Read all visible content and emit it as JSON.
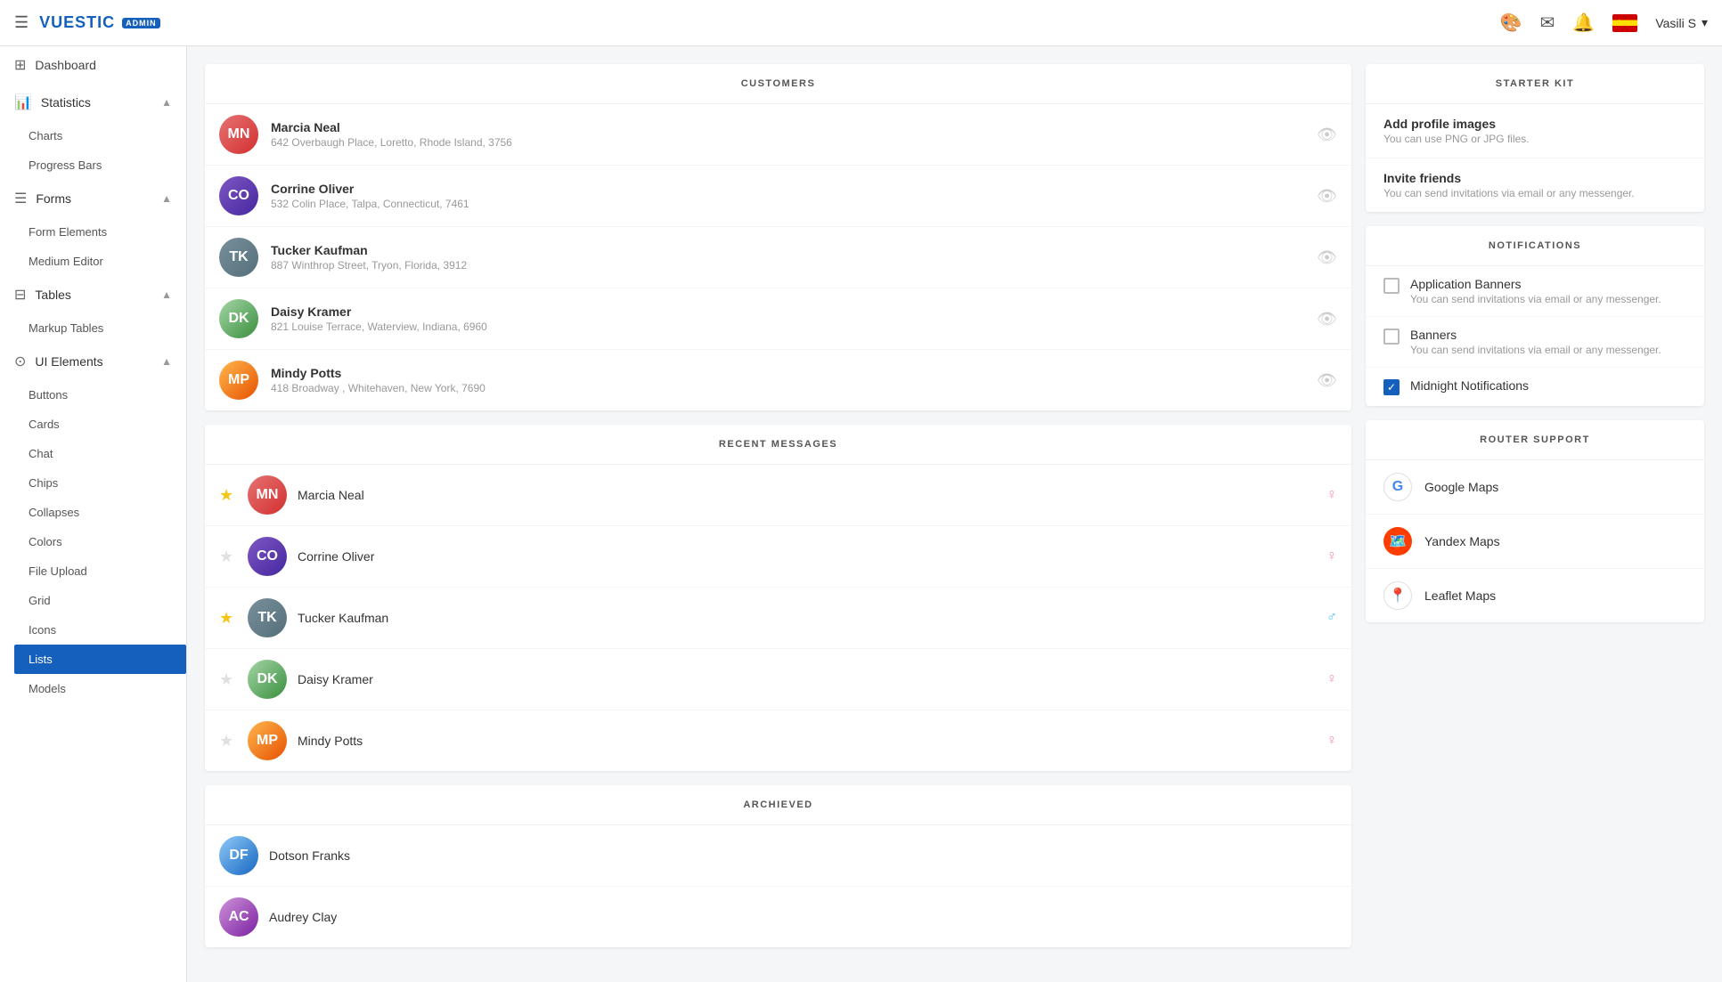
{
  "topnav": {
    "hamburger": "☰",
    "logo_text": "VUESTIC",
    "logo_badge": "ADMIN",
    "icons": {
      "color_wheel": "🎨",
      "mail": "✉",
      "bell": "🔔"
    },
    "user": "Vasili S",
    "user_chevron": "▾"
  },
  "sidebar": {
    "items": [
      {
        "id": "dashboard",
        "icon": "⊞",
        "label": "Dashboard"
      },
      {
        "id": "statistics",
        "icon": "📊",
        "label": "Statistics",
        "expanded": true,
        "children": [
          "Charts",
          "Progress Bars"
        ]
      },
      {
        "id": "forms",
        "icon": "☰",
        "label": "Forms",
        "expanded": true,
        "children": [
          "Form Elements",
          "Medium Editor"
        ]
      },
      {
        "id": "tables",
        "icon": "⊟",
        "label": "Tables",
        "expanded": true,
        "children": [
          "Markup Tables"
        ]
      },
      {
        "id": "ui-elements",
        "icon": "⊙",
        "label": "UI Elements",
        "expanded": true,
        "children": [
          "Buttons",
          "Cards",
          "Chat",
          "Chips",
          "Collapses",
          "Colors",
          "File Upload",
          "Grid",
          "Icons",
          "Lists",
          "Models"
        ]
      }
    ],
    "active": "Lists"
  },
  "customers": {
    "title": "CUSTOMERS",
    "items": [
      {
        "name": "Marcia Neal",
        "address": "642 Overbaugh Place, Loretto, Rhode Island, 3756",
        "av": "av1"
      },
      {
        "name": "Corrine Oliver",
        "address": "532 Colin Place, Talpa, Connecticut, 7461",
        "av": "av2"
      },
      {
        "name": "Tucker Kaufman",
        "address": "887 Winthrop Street, Tryon, Florida, 3912",
        "av": "av3"
      },
      {
        "name": "Daisy Kramer",
        "address": "821 Louise Terrace, Waterview, Indiana, 6960",
        "av": "av4"
      },
      {
        "name": "Mindy Potts",
        "address": "418 Broadway , Whitehaven, New York, 7690",
        "av": "av5"
      }
    ]
  },
  "recent_messages": {
    "title": "RECENT MESSAGES",
    "items": [
      {
        "name": "Marcia Neal",
        "starred": true,
        "gender": "female",
        "av": "av1"
      },
      {
        "name": "Corrine Oliver",
        "starred": false,
        "gender": "female",
        "av": "av2"
      },
      {
        "name": "Tucker Kaufman",
        "starred": true,
        "gender": "male",
        "av": "av3"
      },
      {
        "name": "Daisy Kramer",
        "starred": false,
        "gender": "female",
        "av": "av4"
      },
      {
        "name": "Mindy Potts",
        "starred": false,
        "gender": "female",
        "av": "av5"
      }
    ]
  },
  "archived": {
    "title": "ARCHIEVED",
    "items": [
      {
        "name": "Dotson Franks",
        "av": "av6"
      },
      {
        "name": "Audrey Clay",
        "av": "av7"
      }
    ]
  },
  "starter_kit": {
    "title": "STARTER KIT",
    "items": [
      {
        "title": "Add profile images",
        "sub": "You can use PNG or JPG files."
      },
      {
        "title": "Invite friends",
        "sub": "You can send invitations via email or any messenger."
      }
    ]
  },
  "notifications": {
    "title": "NOTIFICATIONS",
    "items": [
      {
        "title": "Application Banners",
        "sub": "You can send invitations via email or any messenger.",
        "checked": false
      },
      {
        "title": "Banners",
        "sub": "You can send invitations via email or any messenger.",
        "checked": false
      },
      {
        "title": "Midnight Notifications",
        "sub": "",
        "checked": true
      }
    ]
  },
  "router_support": {
    "title": "ROUTER SUPPORT",
    "items": [
      {
        "label": "Google Maps",
        "icon": "G",
        "style": "router-g"
      },
      {
        "label": "Yandex Maps",
        "icon": "🗺",
        "style": "router-y"
      },
      {
        "label": "Leaflet Maps",
        "icon": "📍",
        "style": "router-l"
      }
    ]
  }
}
